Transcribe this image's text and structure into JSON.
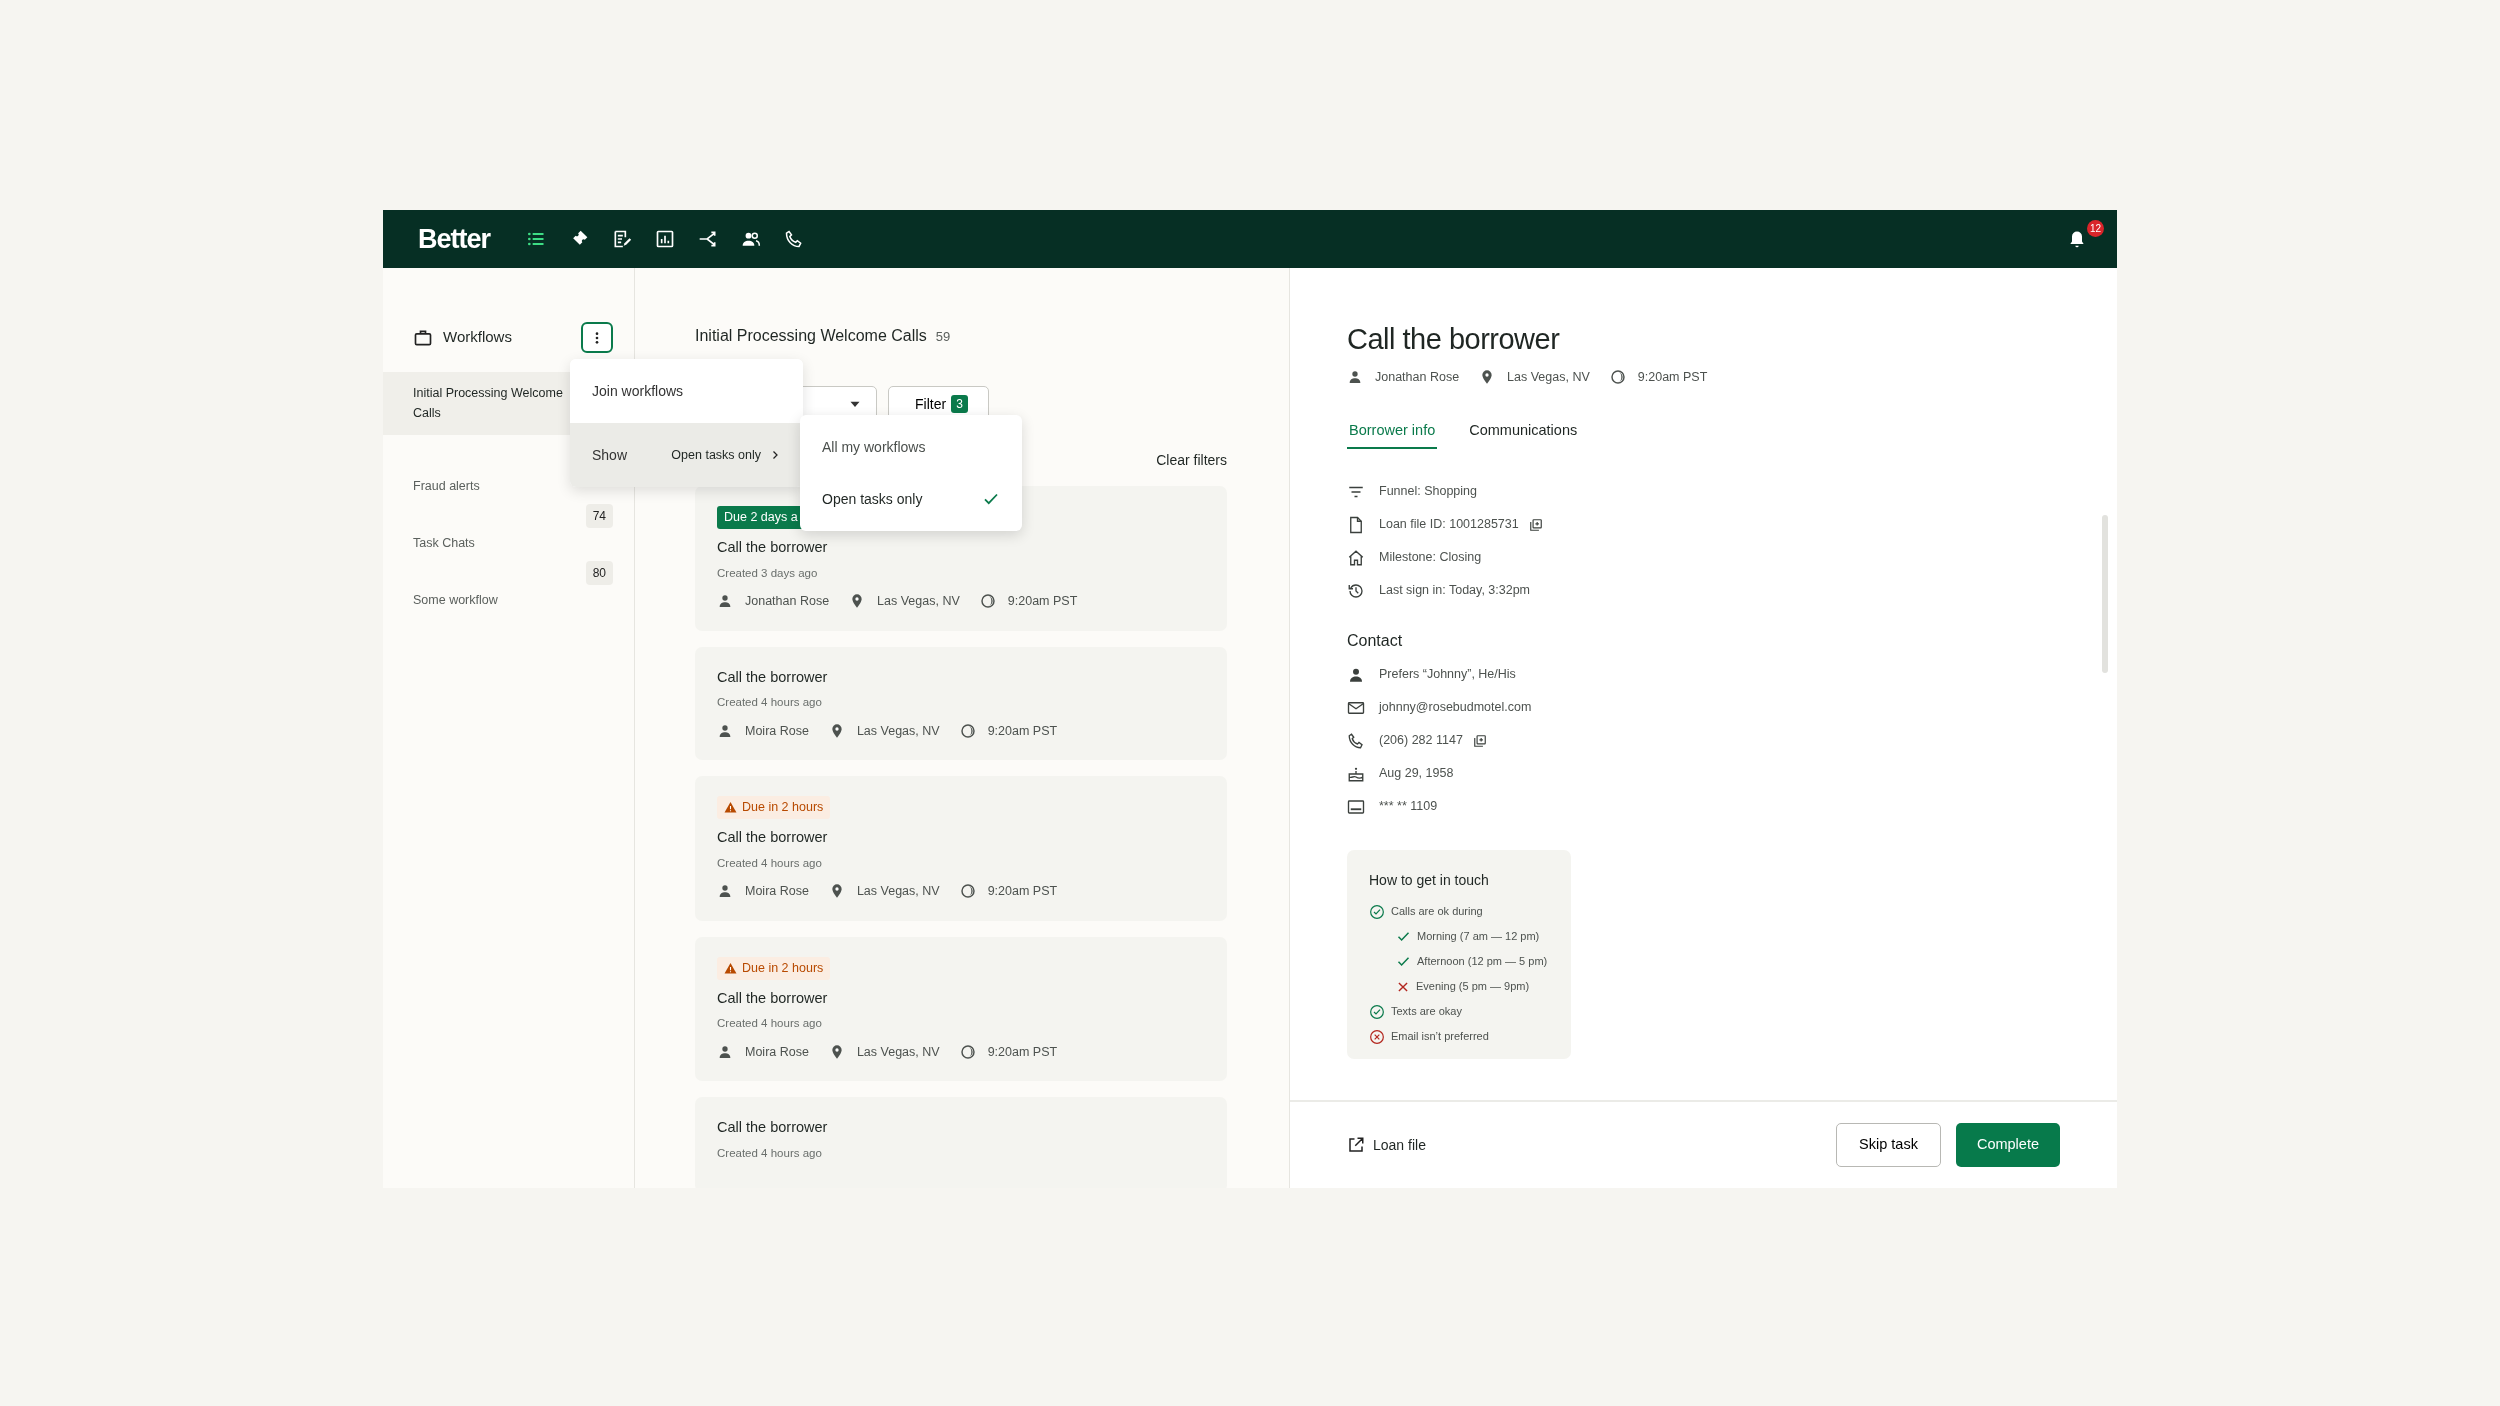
{
  "app": {
    "logo": "Better"
  },
  "nav": [
    {
      "selected": true
    },
    {
      "selected": false
    },
    {
      "selected": false
    },
    {
      "selected": false
    },
    {
      "selected": false
    },
    {
      "selected": false
    },
    {
      "selected": false
    }
  ],
  "notifications": {
    "count": "12"
  },
  "sidebar": {
    "title": "Workflows",
    "menu_open": true,
    "items": [
      {
        "label": "Initial Processing Welcome Calls",
        "selected": true
      },
      {
        "label": "Fraud alerts",
        "selected": false,
        "count": "74"
      },
      {
        "label": "Task Chats",
        "selected": false,
        "count": "80"
      },
      {
        "label": "Some workflow",
        "selected": false
      }
    ]
  },
  "menu": {
    "items": [
      {
        "kind": "action",
        "label": "Join workflows",
        "highlighted": false
      },
      {
        "kind": "submenu",
        "label": "Show",
        "value": "Open tasks only",
        "highlighted": true
      }
    ],
    "submenu": [
      {
        "label": "All my workflows",
        "selected": false
      },
      {
        "label": "Open tasks only",
        "selected": true
      }
    ]
  },
  "task_list": {
    "title": "Initial Processing Welcome Calls",
    "count": "59",
    "filter": {
      "label": "Filter",
      "count": "3"
    },
    "clear": "Clear filters",
    "tasks": [
      {
        "badge": {
          "kind": "overdue",
          "text": "Due 2 days a"
        },
        "title": "Call the borrower",
        "created": "Created 3 days ago",
        "meta": {
          "person": "Jonathan Rose",
          "location": "Las Vegas, NV",
          "time": "9:20am PST"
        }
      },
      {
        "title": "Call the borrower",
        "created": "Created 4 hours ago",
        "meta": {
          "person": "Moira Rose",
          "location": "Las Vegas, NV",
          "time": "9:20am PST"
        }
      },
      {
        "badge": {
          "kind": "warning",
          "text": "Due in 2 hours"
        },
        "title": "Call the borrower",
        "created": "Created 4 hours ago",
        "meta": {
          "person": "Moira Rose",
          "location": "Las Vegas, NV",
          "time": "9:20am PST"
        }
      },
      {
        "badge": {
          "kind": "warning",
          "text": "Due in 2 hours"
        },
        "title": "Call the borrower",
        "created": "Created 4 hours ago",
        "meta": {
          "person": "Moira Rose",
          "location": "Las Vegas, NV",
          "time": "9:20am PST"
        }
      },
      {
        "title": "Call the borrower",
        "created": "Created 4 hours ago"
      }
    ]
  },
  "detail": {
    "title": "Call the borrower",
    "meta": {
      "person": "Jonathan Rose",
      "location": "Las Vegas, NV",
      "time": "9:20am PST"
    },
    "tabs": [
      {
        "label": "Borrower info",
        "selected": true
      },
      {
        "label": "Communications",
        "selected": false
      }
    ],
    "info": [
      {
        "kind": "funnel",
        "text": "Funnel: Shopping",
        "copyable": false
      },
      {
        "kind": "file",
        "text": "Loan file ID: 1001285731",
        "copyable": true
      },
      {
        "kind": "milestone",
        "text": "Milestone: Closing",
        "copyable": false
      },
      {
        "kind": "history",
        "text": "Last sign in: Today, 3:32pm",
        "copyable": false
      }
    ],
    "contact_title": "Contact",
    "contact": [
      {
        "kind": "person",
        "text": "Prefers “Johnny”, He/His",
        "copyable": false
      },
      {
        "kind": "email",
        "text": "johnny@rosebudmotel.com",
        "copyable": false
      },
      {
        "kind": "phone",
        "text": "(206) 282 1147",
        "copyable": true
      },
      {
        "kind": "birthday",
        "text": "Aug 29, 1958",
        "copyable": false
      },
      {
        "kind": "id_card",
        "text": "*** ** 1109",
        "copyable": false
      }
    ],
    "touch": {
      "title": "How to get in touch",
      "items": [
        {
          "kind": "yes",
          "text": "Calls are ok during",
          "children": [
            {
              "kind": "yes",
              "text": "Morning (7 am — 12 pm)"
            },
            {
              "kind": "yes",
              "text": "Afternoon (12 pm — 5 pm)"
            },
            {
              "kind": "no",
              "text": "Evening (5 pm — 9pm)"
            }
          ]
        },
        {
          "kind": "yes",
          "text": "Texts are okay"
        },
        {
          "kind": "no",
          "text": "Email isn’t preferred"
        }
      ]
    },
    "footer": {
      "link": "Loan file",
      "buttons": [
        {
          "kind": "secondary",
          "label": "Skip task"
        },
        {
          "kind": "primary",
          "label": "Complete"
        }
      ]
    }
  }
}
